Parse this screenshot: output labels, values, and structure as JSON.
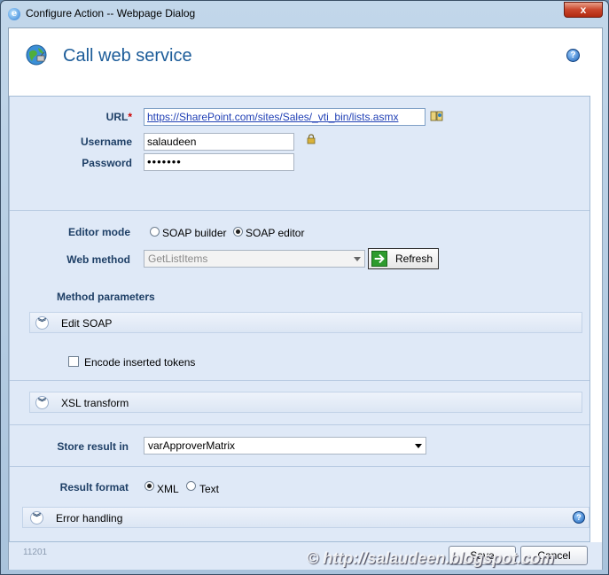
{
  "window": {
    "title": "Configure Action -- Webpage Dialog",
    "close_label": "x"
  },
  "header": {
    "title": "Call web service",
    "help_label": "?"
  },
  "form": {
    "url_label": "URL",
    "url_required_mark": "*",
    "url_value": "https://SharePoint.com/sites/Sales/_vti_bin/lists.asmx",
    "username_label": "Username",
    "username_value": "salaudeen",
    "password_label": "Password",
    "password_value": "•••••••",
    "editor_mode_label": "Editor mode",
    "editor_mode_options": [
      "SOAP builder",
      "SOAP editor"
    ],
    "editor_mode_selected": "SOAP editor",
    "web_method_label": "Web method",
    "web_method_value": "GetListItems",
    "refresh_label": "Refresh",
    "method_parameters_label": "Method parameters",
    "edit_soap_label": "Edit SOAP",
    "encode_tokens_label": "Encode inserted tokens",
    "encode_tokens_checked": false,
    "xsl_transform_label": "XSL transform",
    "store_result_label": "Store result in",
    "store_result_value": "varApproverMatrix",
    "result_format_label": "Result format",
    "result_format_options": [
      "XML",
      "Text"
    ],
    "result_format_selected": "XML",
    "error_handling_label": "Error handling"
  },
  "footer": {
    "build_number": "11201",
    "save_label": "Save",
    "cancel_label": "Cancel",
    "watermark": "© http://salaudeen.blogspot.com"
  },
  "icons": {
    "globe": "globe-satellite-icon",
    "lock": "lock-icon",
    "address_book": "address-book-icon",
    "help": "help-icon",
    "expand": "chevron-double-down-icon"
  }
}
